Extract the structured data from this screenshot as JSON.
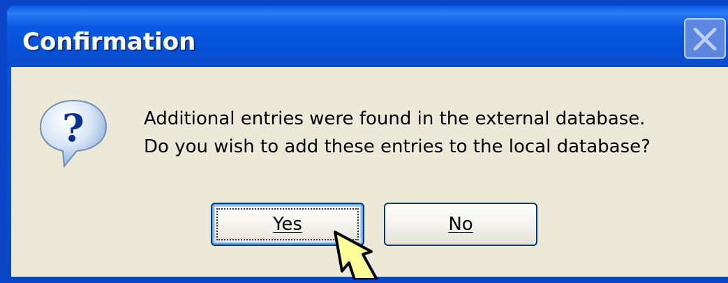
{
  "dialog": {
    "title": "Confirmation",
    "message_line1": "Additional entries were found in the external database.",
    "message_line2": "Do you wish to add these entries to the local database?",
    "icon": "question-icon"
  },
  "buttons": {
    "yes_label": "Yes",
    "no_label": "No"
  },
  "colors": {
    "titlebar": "#0a58e2",
    "body": "#ece9d8",
    "cursor": "#ffff99"
  }
}
